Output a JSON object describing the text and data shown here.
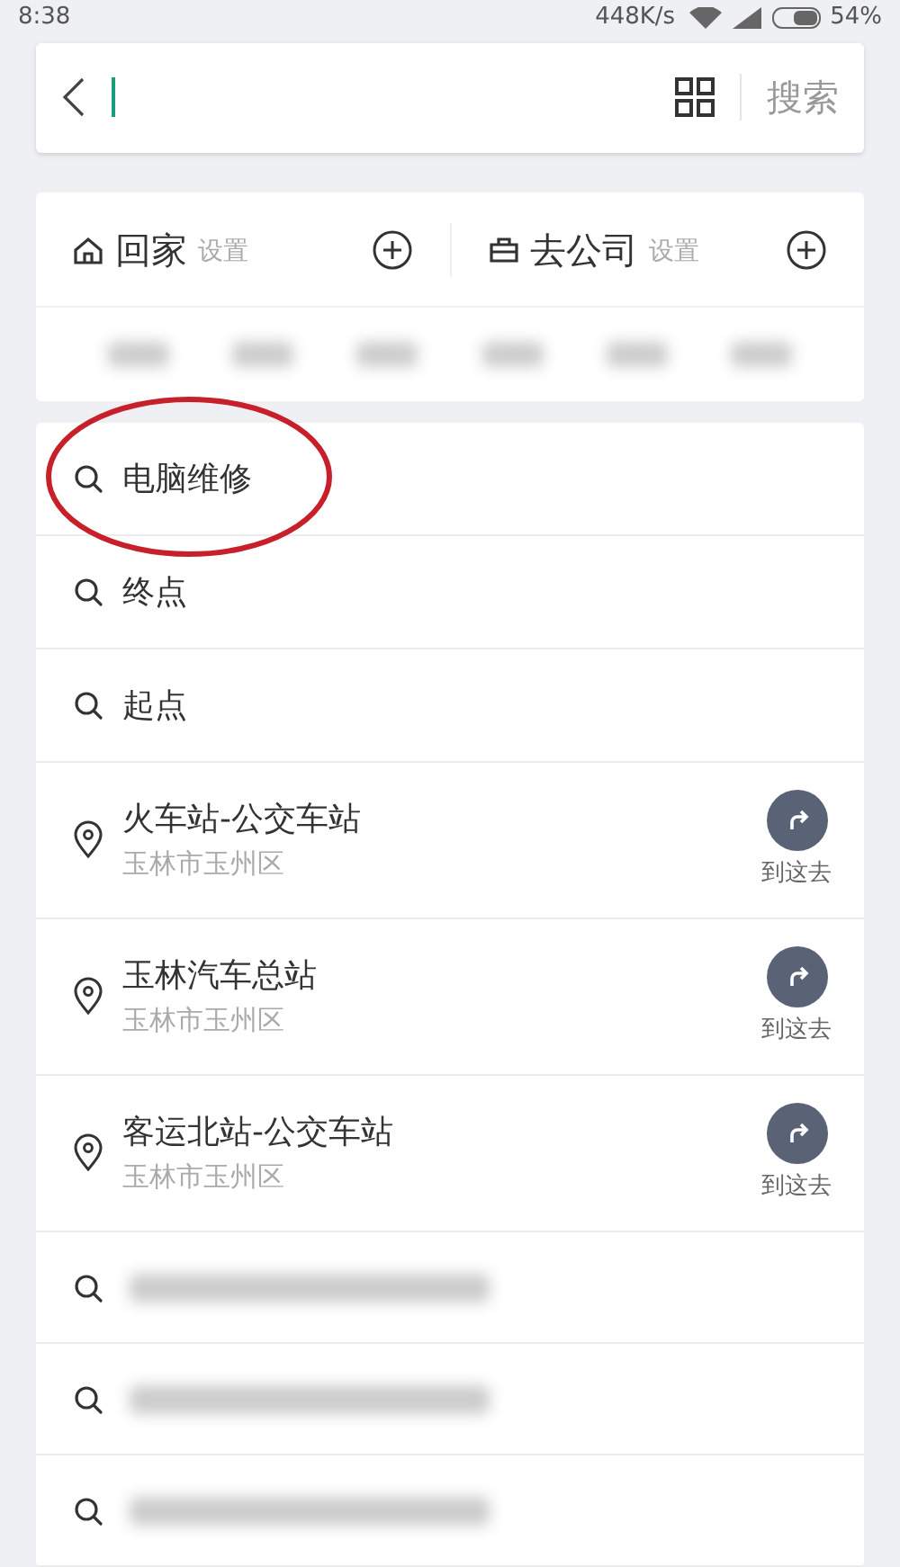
{
  "status_bar": {
    "time": "8:38",
    "speed": "448K/s",
    "battery": "54%"
  },
  "search_bar": {
    "search_button": "搜索"
  },
  "shortcuts": [
    {
      "label": "回家",
      "action": "设置",
      "kind": "home"
    },
    {
      "label": "去公司",
      "action": "设置",
      "kind": "work"
    }
  ],
  "history": [
    {
      "kind": "query",
      "title": "电脑维修",
      "annotated": true
    },
    {
      "kind": "query",
      "title": "终点",
      "annotated": false
    },
    {
      "kind": "query",
      "title": "起点",
      "annotated": false
    },
    {
      "kind": "place",
      "title": "火车站-公交车站",
      "subtitle": "玉林市玉州区",
      "go": "到这去",
      "annotated": false
    },
    {
      "kind": "place",
      "title": "玉林汽车总站",
      "subtitle": "玉林市玉州区",
      "go": "到这去",
      "annotated": false
    },
    {
      "kind": "place",
      "title": "客运北站-公交车站",
      "subtitle": "玉林市玉州区",
      "go": "到这去",
      "annotated": false
    },
    {
      "kind": "blurred",
      "annotated": false
    },
    {
      "kind": "blurred",
      "annotated": false
    },
    {
      "kind": "blurred",
      "annotated": false
    }
  ]
}
